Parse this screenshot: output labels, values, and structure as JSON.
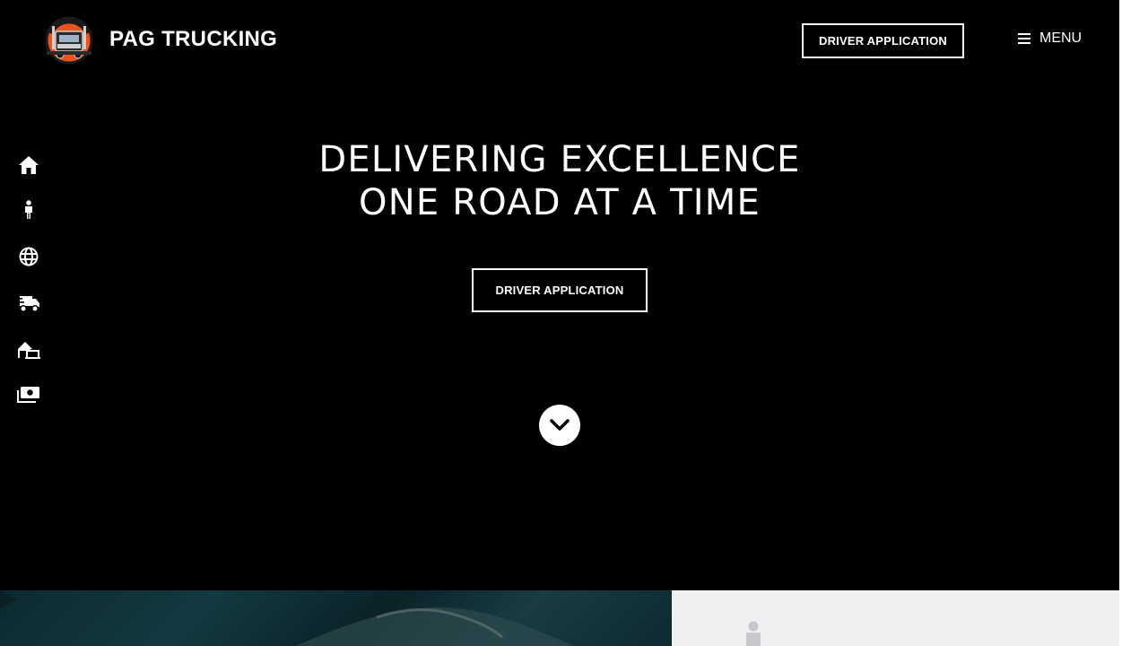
{
  "header": {
    "brand": "PAG TRUCKING",
    "cta_label": "DRIVER APPLICATION",
    "menu_label": "MENU"
  },
  "sidenav": {
    "items": [
      {
        "icon": "home-icon"
      },
      {
        "icon": "person-icon"
      },
      {
        "icon": "globe-icon"
      },
      {
        "icon": "truck-fast-icon"
      },
      {
        "icon": "warehouse-icon"
      },
      {
        "icon": "money-bills-icon"
      }
    ]
  },
  "hero": {
    "line1": "DELIVERING EXCELLENCE",
    "line2": "ONE ROAD AT A TIME",
    "cta_label": "DRIVER APPLICATION",
    "scroll_icon": "chevron-down-icon"
  },
  "colors": {
    "background": "#000000",
    "text": "#ffffff",
    "logo_accent": "#e8541f",
    "card_background": "#f0f0f2"
  }
}
